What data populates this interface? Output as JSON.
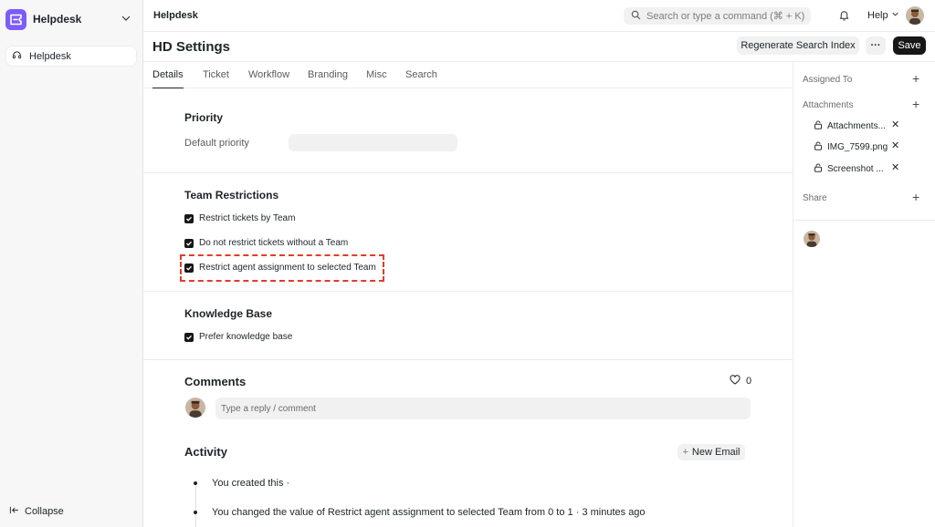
{
  "sidebar": {
    "app_name": "Helpdesk",
    "items": [
      {
        "label": "Helpdesk"
      }
    ],
    "collapse_label": "Collapse"
  },
  "topbar": {
    "breadcrumb": "Helpdesk",
    "search_placeholder": "Search or type a command (⌘ + K)",
    "help_label": "Help"
  },
  "header": {
    "title": "HD Settings",
    "regenerate_label": "Regenerate Search Index",
    "more_label": "···",
    "save_label": "Save"
  },
  "tabs": [
    {
      "label": "Details",
      "active": true
    },
    {
      "label": "Ticket"
    },
    {
      "label": "Workflow"
    },
    {
      "label": "Branding"
    },
    {
      "label": "Misc"
    },
    {
      "label": "Search"
    }
  ],
  "priority": {
    "title": "Priority",
    "default_label": "Default priority",
    "default_value": ""
  },
  "team_restrictions": {
    "title": "Team Restrictions",
    "checks": [
      {
        "label": "Restrict tickets by Team",
        "checked": true
      },
      {
        "label": "Do not restrict tickets without a Team",
        "checked": true
      },
      {
        "label": "Restrict agent assignment to selected Team",
        "checked": true
      }
    ]
  },
  "knowledge_base": {
    "title": "Knowledge Base",
    "checks": [
      {
        "label": "Prefer knowledge base",
        "checked": true
      }
    ]
  },
  "comments": {
    "title": "Comments",
    "likes": "0",
    "placeholder": "Type a reply / comment"
  },
  "activity": {
    "title": "Activity",
    "new_email_label": "New Email",
    "new_email_plus": "+",
    "entries": [
      {
        "text": "You created this ·"
      },
      {
        "prefix": "You changed the value of ",
        "field": "Restrict agent assignment to selected Team",
        "from_word": " from ",
        "from": "0",
        "to_word": " to ",
        "to": "1",
        "suffix": " · 3 minutes ago"
      }
    ]
  },
  "right_panel": {
    "assigned_to": "Assigned To",
    "attachments_label": "Attachments",
    "attachments": [
      {
        "name": "Attachments..."
      },
      {
        "name": "IMG_7599.png"
      },
      {
        "name": "Screenshot ..."
      }
    ],
    "share_label": "Share"
  },
  "colors": {
    "brand": "#7c5cff",
    "highlight": "#e33b2e",
    "primary_button": "#171717"
  }
}
